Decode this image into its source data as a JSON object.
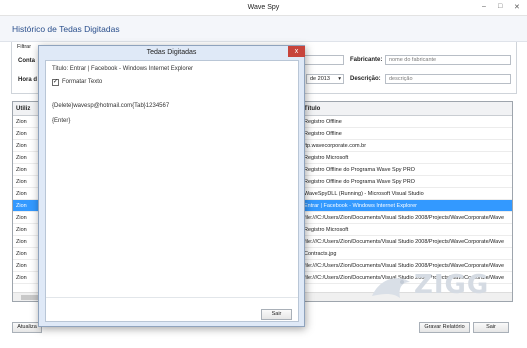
{
  "window": {
    "title": "Wave Spy"
  },
  "header": {
    "title": "Histórico de Tedas Digitadas"
  },
  "filter": {
    "group_label": "Filtrar",
    "conta_label": "Conta",
    "hora_label": "Hora d",
    "fabricante_label": "Fabricante:",
    "fabricante_placeholder": "nome do fabricante",
    "descricao_label": "Descrição:",
    "descricao_placeholder": "descrição",
    "date_value": "de 2013"
  },
  "grid": {
    "columns": [
      "Utiliz",
      "Título"
    ],
    "rows": [
      {
        "user": "Zion",
        "title": "Registro Offline"
      },
      {
        "user": "Zion",
        "title": "Registro Offline"
      },
      {
        "user": "Zion",
        "title": "ftp.wavecorporate.com.br"
      },
      {
        "user": "Zion",
        "title": "Registro Microsoft"
      },
      {
        "user": "Zion",
        "title": "Registro Offline do Programa Wave Spy PRO"
      },
      {
        "user": "Zion",
        "title": "Registro Offline do Programa Wave Spy PRO"
      },
      {
        "user": "Zion",
        "title": "WaveSpyDLL (Running) - Microsoft Visual Studio"
      },
      {
        "user": "Zion",
        "title": "Entrar | Facebook - Windows Internet Explorer",
        "selected": true
      },
      {
        "user": "Zion",
        "title": "file:///C:/Users/Zion/Documents/Visual Studio 2008/Projects/WaveCorporate/Wave"
      },
      {
        "user": "Zion",
        "title": "Registro Microsoft"
      },
      {
        "user": "Zion",
        "title": "file:///C:/Users/Zion/Documents/Visual Studio 2008/Projects/WaveCorporate/Wave"
      },
      {
        "user": "Zion",
        "title": "Contracts.jpg"
      },
      {
        "user": "Zion",
        "title": "file:///C:/Users/Zion/Documents/Visual Studio 2008/Projects/WaveCorporate/Wave"
      },
      {
        "user": "Zion",
        "title": "file:///C:/Users/Zion/Documents/Visual Studio 2008/Projects/WaveCorporate/Wave"
      }
    ]
  },
  "footer": {
    "update_label": "Atualiza",
    "save_report_label": "Gravar Relatório",
    "exit_label": "Sair"
  },
  "dialog": {
    "title": "Tedas Digitadas",
    "close_glyph": "x",
    "window_title_line": "Titulo: Entrar | Facebook - Windows Internet Explorer",
    "format_checkbox_label": "Formatar Texto",
    "checkbox_glyph": "✓",
    "checked": true,
    "typed_line_1": "{Delete}wavesp@hotmail.com{Tab}1234567",
    "typed_line_2": "{Enter}",
    "exit_label": "Sair"
  },
  "watermark": {
    "text": "ZIGG"
  },
  "colors": {
    "selection": "#3399ff",
    "header_text": "#2a4f8c",
    "close": "#c7443b"
  }
}
